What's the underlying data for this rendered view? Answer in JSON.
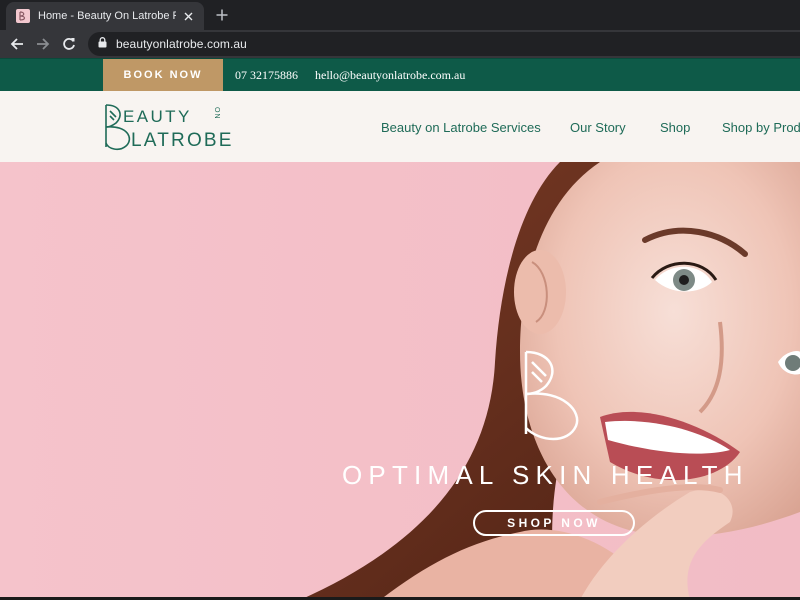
{
  "browser": {
    "tab_title": "Home - Beauty On Latrobe Paddi",
    "url": "beautyonlatrobe.com.au",
    "icons": [
      "favicon-icon",
      "close-icon",
      "new-tab-icon",
      "back-arrow-icon",
      "forward-arrow-icon",
      "reload-icon",
      "lock-icon"
    ]
  },
  "topbar": {
    "book_now": "BOOK NOW",
    "phone": "07 32175886",
    "email": "hello@beautyonlatrobe.com.au"
  },
  "header": {
    "logo": {
      "line1": "EAUTY",
      "line2": "LATROBE",
      "on_text": "ON"
    },
    "nav": [
      {
        "label": "Beauty on Latrobe Services"
      },
      {
        "label": "Our Story"
      },
      {
        "label": "Shop"
      },
      {
        "label": "Shop by Produ"
      }
    ]
  },
  "hero": {
    "headline": "OPTIMAL SKIN HEALTH",
    "cta": "SHOP NOW"
  },
  "colors": {
    "brand_green": "#0e5a48",
    "book_gold": "#bf9866",
    "header_bg": "#f8f4f1",
    "hero_pink": "#f4c2ca",
    "nav_text": "#1f6b58"
  }
}
